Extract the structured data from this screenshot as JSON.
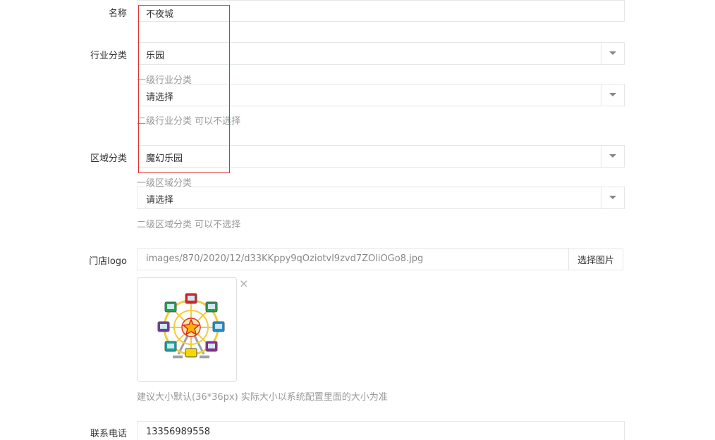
{
  "form": {
    "name": {
      "label": "名称",
      "value": "不夜城"
    },
    "industry": {
      "label": "行业分类",
      "level1_value": "乐园",
      "level1_help": "一级行业分类",
      "level2_value": "请选择",
      "level2_help": "二级行业分类 可以不选择"
    },
    "region": {
      "label": "区域分类",
      "level1_value": "魔幻乐园",
      "level1_help": "一级区域分类",
      "level2_value": "请选择",
      "level2_help": "二级区域分类 可以不选择"
    },
    "logo": {
      "label": "门店logo",
      "path": "images/870/2020/12/d33KKppy9qOziotvl9zvd7ZOliOGo8.jpg",
      "select_button": "选择图片",
      "remove_glyph": "×",
      "help": "建议大小默认(36*36px) 实际大小以系统配置里面的大小为准"
    },
    "phone": {
      "label": "联系电话",
      "value": "13356989558"
    }
  },
  "colors": {
    "border": "#e5e6e7",
    "help_text": "#999999",
    "highlight": "#e0322f"
  },
  "icons": {
    "dropdown": "caret-down-icon",
    "remove": "close-icon",
    "logo_image": "ferris-wheel-icon"
  }
}
